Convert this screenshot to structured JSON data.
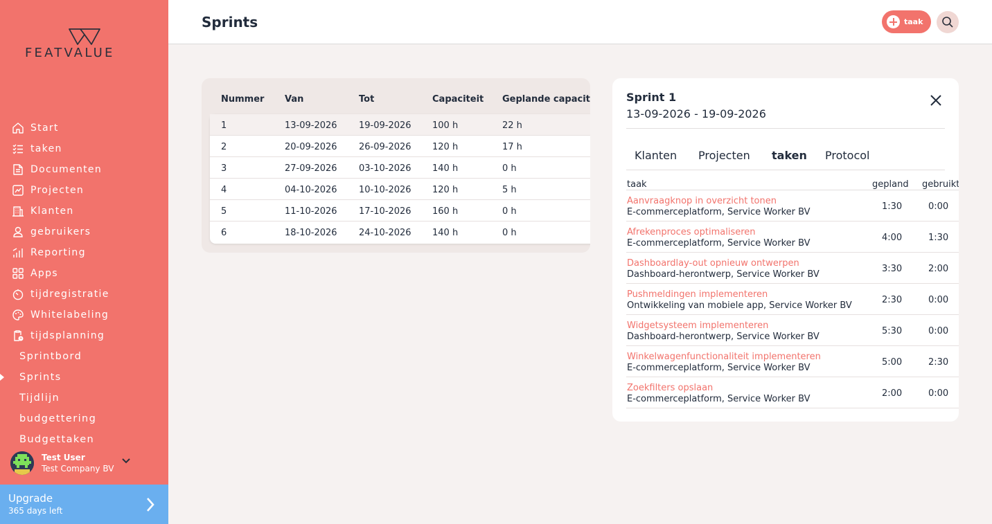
{
  "brand": {
    "name": "FEATVALUE"
  },
  "sidebar": {
    "items": [
      {
        "label": "Start",
        "icon": "home-icon"
      },
      {
        "label": "taken",
        "icon": "checklist-icon"
      },
      {
        "label": "Documenten",
        "icon": "document-icon"
      },
      {
        "label": "Projecten",
        "icon": "chart-icon"
      },
      {
        "label": "Klanten",
        "icon": "building-icon"
      },
      {
        "label": "gebruikers",
        "icon": "user-icon"
      },
      {
        "label": "Reporting",
        "icon": "bar-chart-icon"
      },
      {
        "label": "Apps",
        "icon": "apps-icon"
      },
      {
        "label": "tijdregistratie",
        "icon": "timer-icon"
      },
      {
        "label": "Whitelabeling",
        "icon": "palette-icon"
      },
      {
        "label": "tijdsplanning",
        "icon": "clipboard-clock-icon"
      }
    ],
    "sub_items": [
      {
        "label": "Sprintbord"
      },
      {
        "label": "Sprints"
      },
      {
        "label": "Tijdlijn"
      },
      {
        "label": "budgettering"
      },
      {
        "label": "Budgettaken"
      }
    ],
    "active_sub": "Sprints"
  },
  "user": {
    "name": "Test User",
    "company": "Test Company BV"
  },
  "upgrade": {
    "title": "Upgrade",
    "subtitle": "365 days left"
  },
  "header": {
    "title": "Sprints",
    "add_label": "taak"
  },
  "sprints_table": {
    "headers": [
      "Nummer",
      "Van",
      "Tot",
      "Capaciteit",
      "Geplande capacite"
    ],
    "rows": [
      [
        "1",
        "13-09-2026",
        "19-09-2026",
        "100 h",
        "22 h"
      ],
      [
        "2",
        "20-09-2026",
        "26-09-2026",
        "120 h",
        "17 h"
      ],
      [
        "3",
        "27-09-2026",
        "03-10-2026",
        "140 h",
        "0 h"
      ],
      [
        "4",
        "04-10-2026",
        "10-10-2026",
        "120 h",
        "5 h"
      ],
      [
        "5",
        "11-10-2026",
        "17-10-2026",
        "160 h",
        "0 h"
      ],
      [
        "6",
        "18-10-2026",
        "24-10-2026",
        "140 h",
        "0 h"
      ]
    ]
  },
  "panel": {
    "title": "Sprint 1",
    "dates": "13-09-2026 - 19-09-2026",
    "tabs": [
      "Klanten",
      "Projecten",
      "taken",
      "Protocol"
    ],
    "active_tab": "taken",
    "columns": [
      "taak",
      "gepland",
      "gebruikt"
    ],
    "tasks": [
      {
        "name": "Aanvraagknop in overzicht tonen",
        "sub": "E-commerceplatform, Service Worker BV",
        "planned": "1:30",
        "used": "0:00"
      },
      {
        "name": "Afrekenproces optimaliseren",
        "sub": "E-commerceplatform, Service Worker BV",
        "planned": "4:00",
        "used": "1:30"
      },
      {
        "name": "Dashboardlay-out opnieuw ontwerpen",
        "sub": "Dashboard-herontwerp, Service Worker BV",
        "planned": "3:30",
        "used": "2:00"
      },
      {
        "name": "Pushmeldingen implementeren",
        "sub": "Ontwikkeling van mobiele app, Service Worker BV",
        "planned": "2:30",
        "used": "0:00"
      },
      {
        "name": "Widgetsysteem implementeren",
        "sub": "Dashboard-herontwerp, Service Worker BV",
        "planned": "5:30",
        "used": "0:00"
      },
      {
        "name": "Winkelwagenfunctionaliteit implementeren",
        "sub": "E-commerceplatform, Service Worker BV",
        "planned": "5:00",
        "used": "2:30"
      },
      {
        "name": "Zoekfilters opslaan",
        "sub": "E-commerceplatform, Service Worker BV",
        "planned": "2:00",
        "used": "0:00"
      }
    ]
  },
  "colors": {
    "accent": "#f2736c",
    "upgrade": "#6aafef",
    "text": "#222c3c",
    "background": "#f6f2f1"
  }
}
